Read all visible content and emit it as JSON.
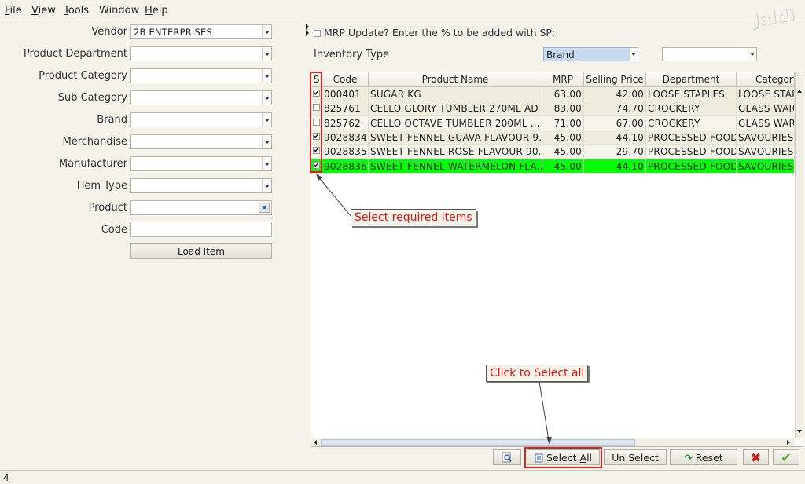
{
  "menu": [
    {
      "mnemonic": "F",
      "rest": "ile"
    },
    {
      "mnemonic": "V",
      "rest": "iew"
    },
    {
      "mnemonic": "T",
      "rest": "ools"
    },
    {
      "mnemonic": "",
      "rest": "Window"
    },
    {
      "mnemonic": "H",
      "rest": "elp"
    }
  ],
  "logo_text": "Jaldi",
  "filters": {
    "vendor": {
      "label": "Vendor",
      "value": "2B ENTERPRISES"
    },
    "product_department": {
      "label": "Product Department",
      "value": ""
    },
    "product_category": {
      "label": "Product Category",
      "value": ""
    },
    "sub_category": {
      "label": "Sub Category",
      "value": ""
    },
    "brand": {
      "label": "Brand",
      "value": ""
    },
    "merchandise": {
      "label": "Merchandise",
      "value": ""
    },
    "manufacturer": {
      "label": "Manufacturer",
      "value": ""
    },
    "item_type": {
      "label": "ITem Type",
      "value": ""
    },
    "product": {
      "label": "Product",
      "value": ""
    },
    "code": {
      "label": "Code",
      "value": ""
    },
    "load_button": "Load Item"
  },
  "mrp_update_label": "MRP Update? Enter the % to be added with SP:",
  "inventory_type": {
    "label": "Inventory Type",
    "value": "Brand",
    "second_value": ""
  },
  "grid": {
    "columns": [
      "S",
      "Code",
      "Product Name",
      "MRP",
      "Selling Price",
      "Department",
      "Category"
    ],
    "rows": [
      {
        "checked": true,
        "code": "000401",
        "name": "SUGAR KG",
        "mrp": "63.00",
        "sp": "42.00",
        "dept": "LOOSE STAPLES",
        "cat": "LOOSE STAPLES"
      },
      {
        "checked": false,
        "code": "825761",
        "name": "CELLO GLORY TUMBLER 270ML AD",
        "mrp": "83.00",
        "sp": "74.70",
        "dept": "CROCKERY",
        "cat": "GLASS WARE"
      },
      {
        "checked": false,
        "code": "825762",
        "name": "CELLO OCTAVE TUMBLER 200ML ...",
        "mrp": "71.00",
        "sp": "67.00",
        "dept": "CROCKERY",
        "cat": "GLASS WARE"
      },
      {
        "checked": true,
        "code": "9028834",
        "name": "SWEET FENNEL GUAVA FLAVOUR 9...",
        "mrp": "45.00",
        "sp": "44.10",
        "dept": "PROCESSED FOOD",
        "cat": "SAVOURIES"
      },
      {
        "checked": true,
        "code": "9028835",
        "name": "SWEET FENNEL ROSE FLAVOUR 90...",
        "mrp": "45.00",
        "sp": "29.70",
        "dept": "PROCESSED FOOD",
        "cat": "SAVOURIES"
      },
      {
        "checked": true,
        "code": "9028836",
        "name": "SWEET FENNEL WATERMELON FLA...",
        "mrp": "45.00",
        "sp": "44.10",
        "dept": "PROCESSED FOOD",
        "cat": "SAVOURIES"
      }
    ]
  },
  "callouts": {
    "select_items": "Select required items",
    "select_all": "Click to Select all"
  },
  "buttons": {
    "select_all_mnemonic": "A",
    "select_all_prefix": "Select ",
    "select_all_suffix": "ll",
    "unselect": "Un Select",
    "reset": "Reset"
  },
  "colors": {
    "highlight_row": "#00ff00",
    "annotation_red": "#e02020",
    "selected_combo": "#c8daf0"
  },
  "status": "4"
}
